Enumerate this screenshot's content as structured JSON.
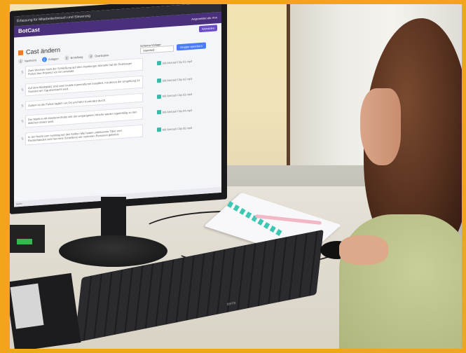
{
  "screen": {
    "system_bar": "Erfassung für Mitarbeiterbesuch und Steuerung",
    "app_title": "BotCast",
    "header_button": "Abmelden",
    "user_label": "Angemeldet als: Ann",
    "page_title": "Cast ändern",
    "steps": [
      {
        "num": "1",
        "label": "Nachricht"
      },
      {
        "num": "2",
        "label": "Anlagen"
      },
      {
        "num": "3",
        "label": "Erstellung"
      },
      {
        "num": "4",
        "label": "Distribution"
      }
    ],
    "schema_label": "Schema-Vorlage",
    "schema_value": "Standard",
    "save_button": "Gruppe speichern",
    "messages": [
      "Zwei Wochen nach der Schließung auf dem Hamburger Abmarkt hat die Duisburger Polizei ihre Präsenz vor Ort verstärkt.",
      "Auf dem Marktplatz sind zwei mobile Kamerafürme installiert, mit denen die Umgebung 24 Stunden am Tag überwacht wird.",
      "Zudem ist die Polizei täglich vor Ort und führt Kontrollen durch.",
      "Der Markt in Alt-Hamborn findet seit der vergangenen Woche wieder regelmäßig zu den üblichen Zeiten statt.",
      "In der Nacht vom sonntag auf den fünften Mai hatten unbekannte Täter und Rockerbanden sich hier eine Schießerei mit mehreren Personen geliefert."
    ],
    "voices": [
      "Bill Ahmadi Clip 01.mp3",
      "Bill Ahmadi Clip 02.mp3",
      "Bill Ahmadi Clip 03.mp3",
      "Bill Ahmadi Clip 04.mp3",
      "Bill Ahmadi Clip 05.mp3"
    ],
    "taskbar_text": "Suche"
  },
  "objects": {
    "keyboard_brand": "terra"
  }
}
